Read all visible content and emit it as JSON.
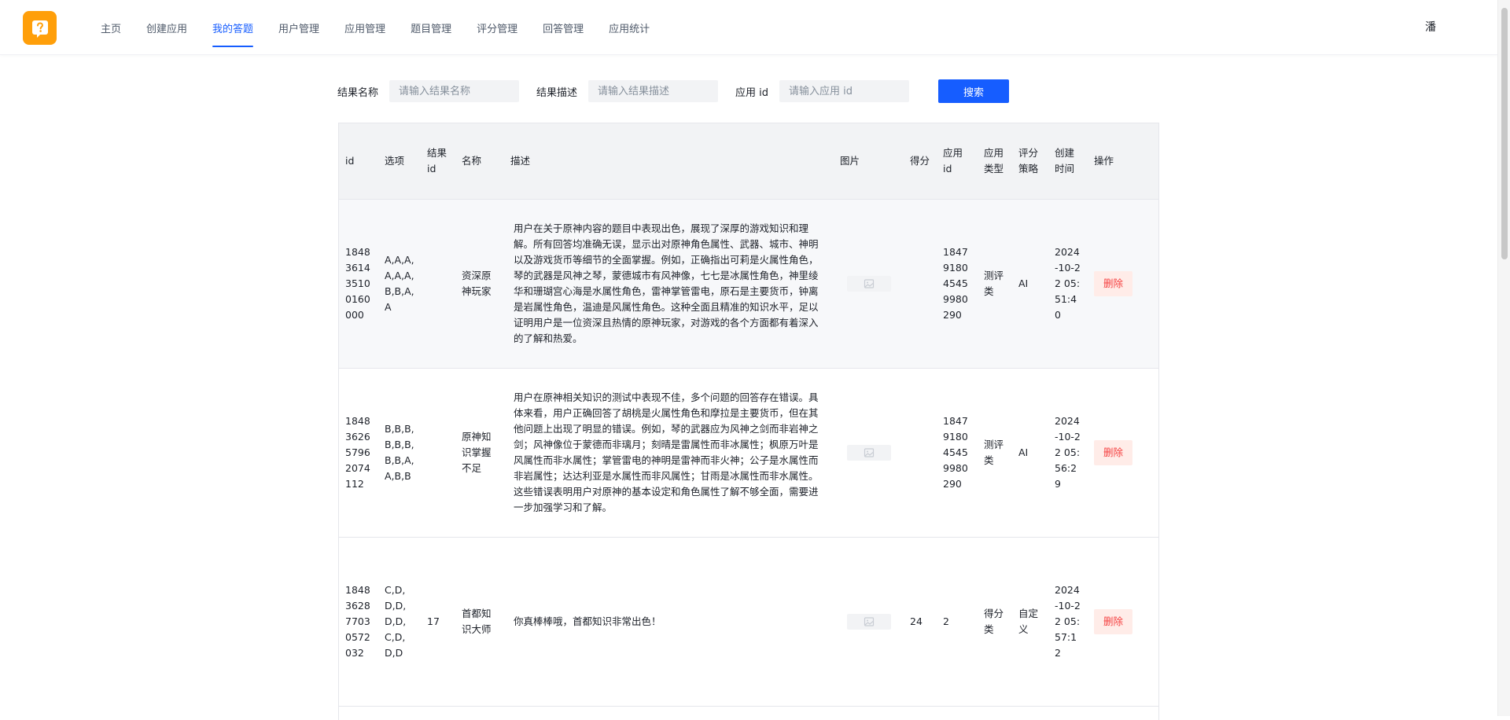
{
  "nav": {
    "items": [
      {
        "label": "主页"
      },
      {
        "label": "创建应用"
      },
      {
        "label": "我的答题"
      },
      {
        "label": "用户管理"
      },
      {
        "label": "应用管理"
      },
      {
        "label": "题目管理"
      },
      {
        "label": "评分管理"
      },
      {
        "label": "回答管理"
      },
      {
        "label": "应用统计"
      }
    ],
    "active_index": 2,
    "user_name": "潘"
  },
  "search": {
    "name_label": "结果名称",
    "name_placeholder": "请输入结果名称",
    "desc_label": "结果描述",
    "desc_placeholder": "请输入结果描述",
    "appid_label": "应用 id",
    "appid_placeholder": "请输入应用 id",
    "button": "搜索"
  },
  "table": {
    "headers": [
      "id",
      "选项",
      "结果id",
      "名称",
      "描述",
      "图片",
      "得分",
      "应用id",
      "应用类型",
      "评分策略",
      "创建时间",
      "操作"
    ],
    "rows": [
      {
        "id": "1848361435100160000",
        "choices": "A,A,A,A,A,A,B,B,A,A",
        "result_id": "",
        "name": "资深原神玩家",
        "desc": "用户在关于原神内容的题目中表现出色，展现了深厚的游戏知识和理解。所有回答均准确无误，显示出对原神角色属性、武器、城市、神明以及游戏货币等细节的全面掌握。例如，正确指出可莉是火属性角色，琴的武器是风神之琴，蒙德城市有风神像，七七是冰属性角色，神里绫华和珊瑚宫心海是水属性角色，雷神掌管雷电，原石是主要货币，钟离是岩属性角色，温迪是风属性角色。这种全面且精准的知识水平，足以证明用户是一位资深且热情的原神玩家，对游戏的各个方面都有着深入的了解和热爱。",
        "score": "",
        "app_id": "1847918045459980290",
        "app_type": "测评类",
        "strategy": "AI",
        "created": "2024-10-22 05:51:40",
        "action": "删除"
      },
      {
        "id": "1848362657962074112",
        "choices": "B,B,B,B,B,B,B,B,A,A,B,B",
        "result_id": "",
        "name": "原神知识掌握不足",
        "desc": "用户在原神相关知识的测试中表现不佳，多个问题的回答存在错误。具体来看，用户正确回答了胡桃是火属性角色和摩拉是主要货币，但在其他问题上出现了明显的错误。例如，琴的武器应为风神之剑而非岩神之剑；风神像位于蒙德而非璃月；刻晴是雷属性而非冰属性；枫原万叶是风属性而非水属性；掌管雷电的神明是雷神而非火神；公子是水属性而非岩属性；达达利亚是水属性而非风属性；甘雨是冰属性而非水属性。这些错误表明用户对原神的基本设定和角色属性了解不够全面，需要进一步加强学习和了解。",
        "score": "",
        "app_id": "1847918045459980290",
        "app_type": "测评类",
        "strategy": "AI",
        "created": "2024-10-22 05:56:29",
        "action": "删除"
      },
      {
        "id": "1848362877030572032",
        "choices": "C,D,D,D,D,D,C,D,D,D",
        "result_id": "17",
        "name": "首都知识大师",
        "desc": "你真棒棒哦，首都知识非常出色！",
        "score": "24",
        "app_id": "2",
        "app_type": "得分类",
        "strategy": "自定义",
        "created": "2024-10-22 05:57:12",
        "action": "删除"
      }
    ]
  },
  "colors": {
    "accent": "#165dff",
    "logo": "#ff9f0a",
    "danger": "#f53f3f",
    "danger_bg": "#ffece8"
  },
  "icons": {
    "logo": "question-bubble-icon",
    "image_placeholder": "image-broken-icon"
  }
}
